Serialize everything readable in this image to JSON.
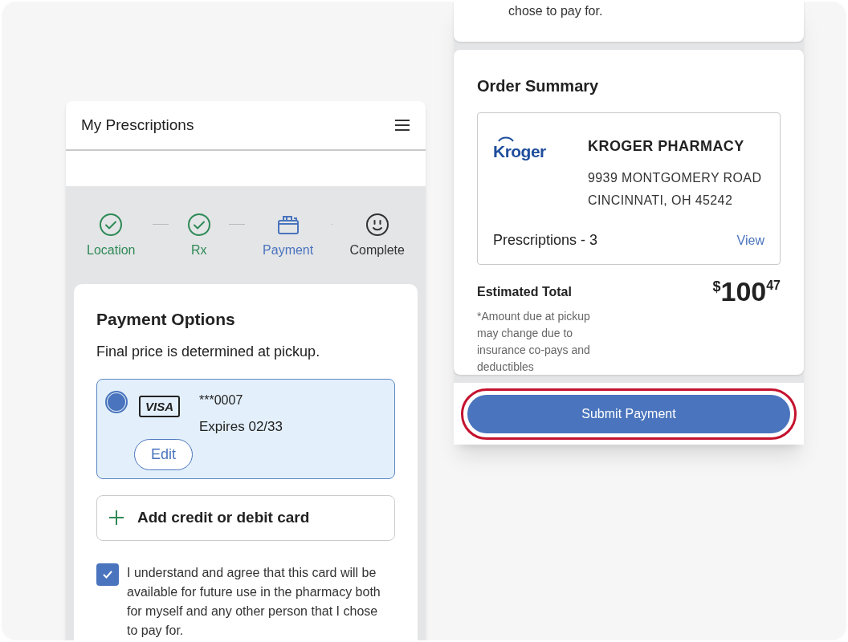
{
  "left_screen": {
    "header": {
      "title": "My Prescriptions"
    },
    "steps": [
      {
        "label": "Location",
        "kind": "check",
        "done": true,
        "selected": false
      },
      {
        "label": "Rx",
        "kind": "check",
        "done": true,
        "selected": false
      },
      {
        "label": "Payment",
        "kind": "wallet",
        "done": false,
        "selected": true
      },
      {
        "label": "Complete",
        "kind": "smiley",
        "done": false,
        "selected": false
      }
    ],
    "payment_options": {
      "title": "Payment Options",
      "subtitle": "Final price is determined at pickup.",
      "cards": [
        {
          "brand": "VISA",
          "number": "***0007",
          "expires": "Expires 02/33",
          "selected": true,
          "edit_label": "Edit"
        }
      ],
      "add_card": "Add credit or debit card",
      "consent": {
        "checked": true,
        "text": "I understand and agree that this card will be available for future use in the pharmacy both for myself and any other person that I chose to pay for."
      }
    }
  },
  "right_screen": {
    "previous_card_tail": "chose to pay for.",
    "order_summary": {
      "title": "Order Summary",
      "store": {
        "logo": "Kroger",
        "name": "KROGER PHARMACY",
        "address_lines": [
          "9939 MONTGOMERY ROAD",
          "CINCINNATI, OH 45242"
        ]
      },
      "prescriptions": "Prescriptions - 3",
      "view_link": "View",
      "total_label": "Estimated Total",
      "currency": "$",
      "amount": "100",
      "cents": "47",
      "note": "*Amount due at pickup may change due to insurance co-pays and deductibles"
    },
    "submit": {
      "label": "Submit Payment",
      "highlighted": true
    }
  }
}
